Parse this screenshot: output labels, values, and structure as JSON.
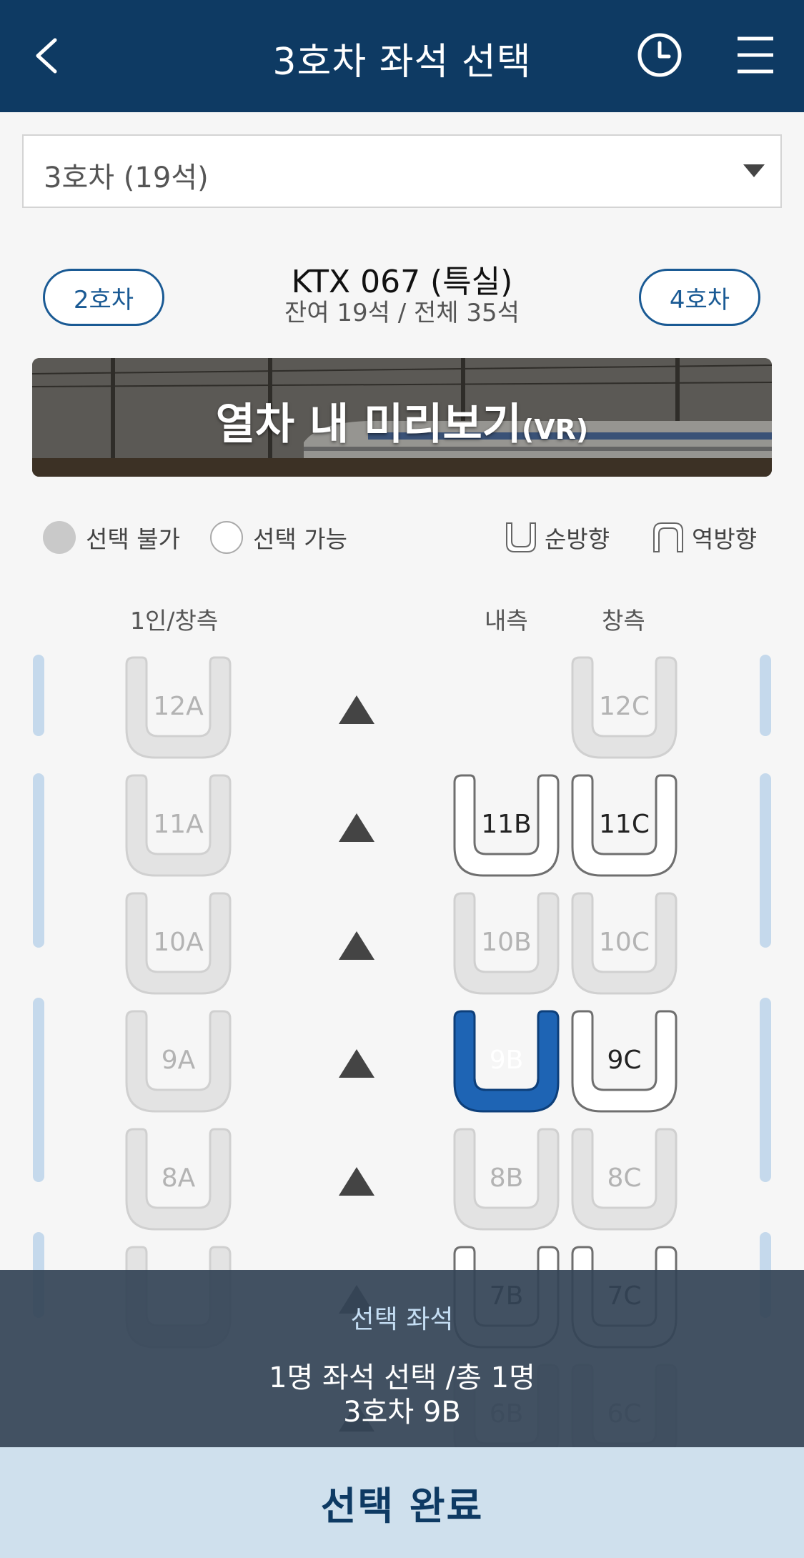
{
  "header": {
    "title": "3호차 좌석 선택",
    "back_icon": "chevron-left-icon",
    "history_icon": "clock-icon",
    "menu_icon": "hamburger-menu-icon"
  },
  "car_select": {
    "value": "3호차 (19석)"
  },
  "train": {
    "prev_car": "2호차",
    "next_car": "4호차",
    "name": "KTX 067 (특실)",
    "seats": "잔여 19석 / 전체 35석"
  },
  "vr_banner": {
    "title": "열차 내 미리보기",
    "suffix": "(VR)"
  },
  "legend": {
    "unavailable": "선택 불가",
    "available": "선택 가능",
    "forward": "순방향",
    "backward": "역방향"
  },
  "columns": {
    "left": "1인/창측",
    "middle": "내측",
    "right": "창측"
  },
  "seats": {
    "12A": "12A",
    "12C": "12C",
    "11A": "11A",
    "11B": "11B",
    "11C": "11C",
    "10A": "10A",
    "10B": "10B",
    "10C": "10C",
    "9A": "9A",
    "9B": "9B",
    "9C": "9C",
    "8A": "8A",
    "8B": "8B",
    "8C": "8C",
    "7B": "7B",
    "7C": "7C",
    "6B": "6B",
    "6C": "6C"
  },
  "summary": {
    "label": "선택 좌석",
    "count": "1명 좌석 선택 /총 1명",
    "seat": "3호차 9B"
  },
  "confirm_button": "선택 완료",
  "colors": {
    "header_bg": "#0e3a63",
    "selected_seat": "#1e64b4",
    "confirm_bg": "#cfe0ed"
  }
}
